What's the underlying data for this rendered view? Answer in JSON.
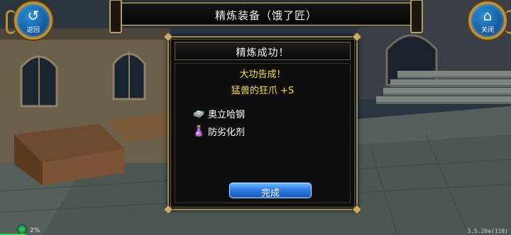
{
  "header": {
    "title": "精炼装备（饿了匠）",
    "back_label": "返回",
    "close_label": "关闭"
  },
  "dialog": {
    "title": "精炼成功！",
    "result_line": "大功告成！",
    "item_line": "猛兽的狂爪 +S",
    "materials": [
      {
        "name": "奥立哈钢",
        "icon": "steel-ingot-icon"
      },
      {
        "name": "防劣化剂",
        "icon": "potion-bottle-icon"
      }
    ],
    "confirm_label": "完成"
  },
  "status": {
    "network_percent": "2%",
    "version": "3.5.20a(118)",
    "loading_progress": 0.05
  },
  "colors": {
    "highlight_text": "#f2e04a",
    "button_blue": "#2f7be0",
    "frame_gold": "#9b8a62"
  }
}
